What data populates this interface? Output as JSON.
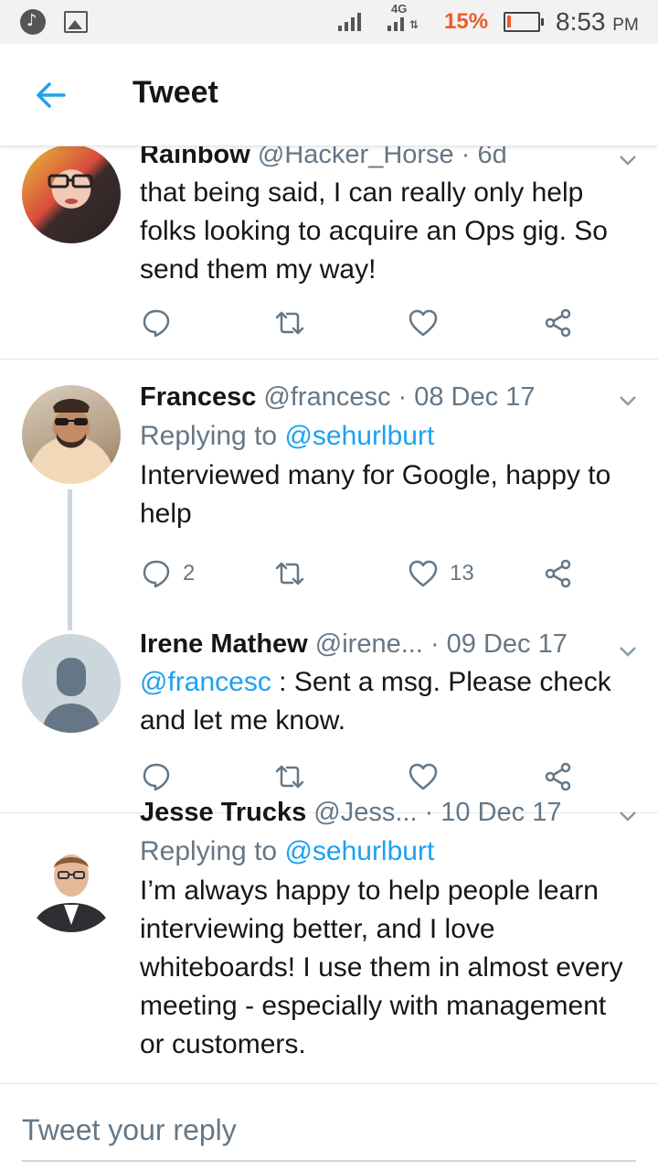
{
  "status_bar": {
    "network": "4G",
    "battery_percent": "15%",
    "time": "8:53",
    "ampm": "PM",
    "battery_color": "#f05a28"
  },
  "header": {
    "title": "Tweet",
    "back_icon": "arrow-left-icon"
  },
  "tweets": [
    {
      "name": "Rainbow",
      "handle": "@Hacker_Horse",
      "date": "· 6d",
      "text": "that being said, I can really only help folks looking to acquire an Ops gig. So send them my way!",
      "reply_count": "",
      "like_count": ""
    },
    {
      "name": "Francesc",
      "handle": "@francesc",
      "date": "· 08 Dec 17",
      "replying_prefix": "Replying to",
      "replying_to": "@sehurlburt",
      "text": "Interviewed many for Google, happy to help",
      "reply_count": "2",
      "like_count": "13"
    },
    {
      "name": "Irene Mathew",
      "handle": "@irene...",
      "date": "· 09 Dec 17",
      "mention": "@francesc",
      "text": " : Sent a msg. Please check and let me know.",
      "reply_count": "",
      "like_count": ""
    },
    {
      "name": "Jesse Trucks",
      "handle": "@Jess...",
      "date": "· 10 Dec 17",
      "replying_prefix": "Replying to",
      "replying_to": "@sehurlburt",
      "text": "I’m always happy to help people learn interviewing better, and I love whiteboards! I use them in almost every meeting - especially with management or customers."
    }
  ],
  "reply_bar": {
    "placeholder": "Tweet your reply"
  },
  "colors": {
    "accent": "#1da1f2",
    "secondary_text": "#657786",
    "primary_text": "#14171a"
  }
}
